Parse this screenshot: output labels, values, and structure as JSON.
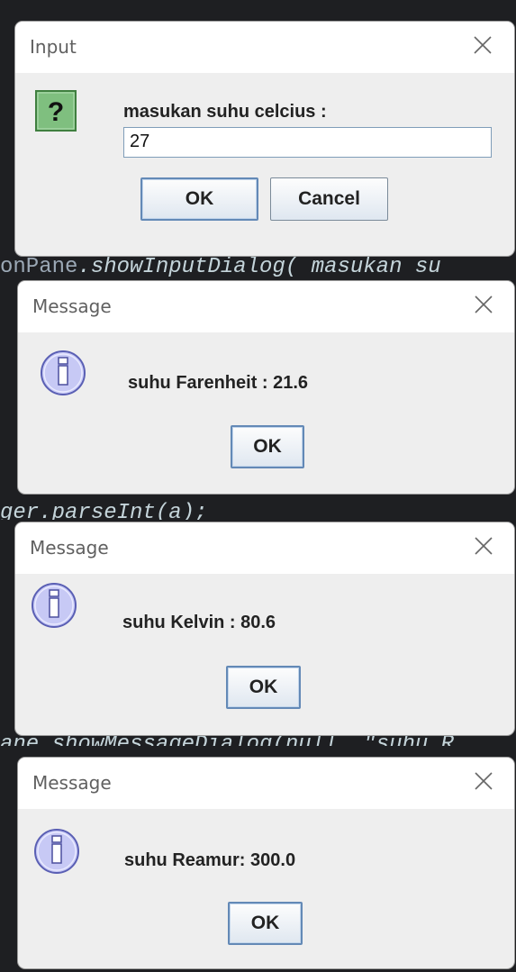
{
  "background_code": {
    "line1": ".showInputDialog( masukan su",
    "line1_prefix": "onPane",
    "line2": "ger.parseInt(a);",
    "line3": "ane.showMessageDialog(null, \"suhu R"
  },
  "dialogs": [
    {
      "title": "Input",
      "icon": "question-icon",
      "message": "masukan suhu celcius :",
      "input_value": "27",
      "buttons": [
        "OK",
        "Cancel"
      ]
    },
    {
      "title": "Message",
      "icon": "information-icon",
      "message": "suhu Farenheit : 21.6",
      "buttons": [
        "OK"
      ]
    },
    {
      "title": "Message",
      "icon": "information-icon",
      "message": "suhu Kelvin : 80.6",
      "buttons": [
        "OK"
      ]
    },
    {
      "title": "Message",
      "icon": "information-icon",
      "message": "suhu Reamur: 300.0",
      "buttons": [
        "OK"
      ]
    }
  ],
  "colors": {
    "question_icon_bg": "#7fbf7f",
    "info_icon_bg": "#c7c9f5"
  }
}
